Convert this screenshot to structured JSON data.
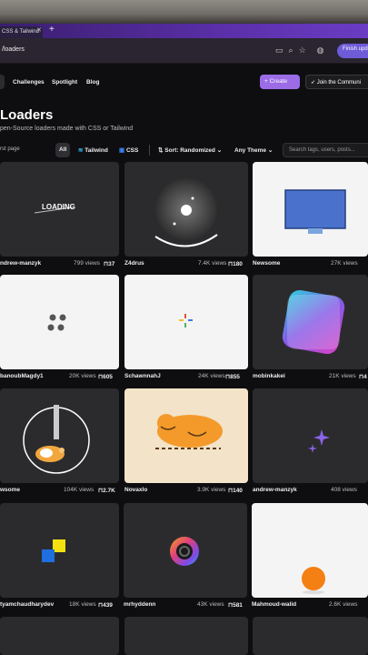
{
  "browser": {
    "tab_title": "CSS & Tailwind",
    "url": "/loaders",
    "finish_update": "Finish upd"
  },
  "nav": {
    "links": [
      "Challenges",
      "Spotlight",
      "Blog"
    ],
    "create": "+ Create",
    "join": "Join the Communi"
  },
  "page": {
    "title": "Loaders",
    "subtitle": "pen-Source loaders made with CSS or Tailwind"
  },
  "filters": {
    "label": "rst page",
    "all": "All",
    "tailwind": "Tailwind",
    "css": "CSS",
    "sort": "Sort: Randomized",
    "theme": "Any Theme",
    "search_placeholder": "Search tags, users, posts..."
  },
  "cards": [
    {
      "author": "ndrew-manzyk",
      "views": "799 views",
      "saves": "37",
      "text": "LOADING"
    },
    {
      "author": "Z4drus",
      "views": "7.4K views",
      "saves": "180"
    },
    {
      "author": "Newsome",
      "views": "27K views",
      "saves": ""
    },
    {
      "author": "banoubMagdy1",
      "views": "20K views",
      "saves": "605"
    },
    {
      "author": "SchawnnahJ",
      "views": "24K views",
      "saves": "855"
    },
    {
      "author": "mobinkakei",
      "views": "21K views",
      "saves": "4"
    },
    {
      "author": "wsome",
      "views": "104K views",
      "saves": "2.7K"
    },
    {
      "author": "Novaxlo",
      "views": "3.9K views",
      "saves": "140"
    },
    {
      "author": "andrew-manzyk",
      "views": "408 views",
      "saves": ""
    },
    {
      "author": "tyamchaudharydev",
      "views": "18K views",
      "saves": "439"
    },
    {
      "author": "mrhyddenn",
      "views": "43K views",
      "saves": "581"
    },
    {
      "author": "Mahmoud-walid",
      "views": "2.6K views",
      "saves": ""
    }
  ]
}
